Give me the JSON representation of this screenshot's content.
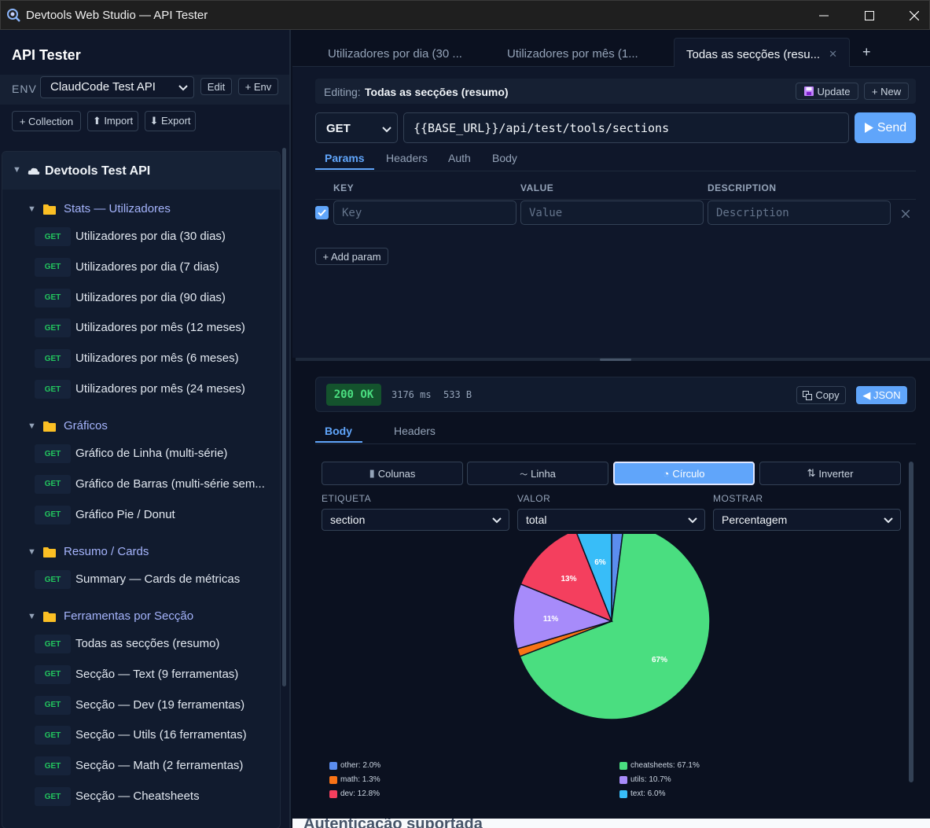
{
  "window": {
    "title": "Devtools Web Studio — API Tester"
  },
  "sidebar": {
    "title": "API Tester",
    "env_label": "ENV",
    "env_value": "ClaudCode Test API",
    "edit_label": "Edit",
    "add_env_label": "+ Env",
    "collection_label": "+ Collection",
    "import_label": "⬆ Import",
    "export_label": "⬇ Export",
    "root": "Devtools Test API",
    "folders": [
      {
        "name": "Stats — Utilizadores",
        "items": [
          {
            "method": "GET",
            "label": "Utilizadores por dia (30 dias)"
          },
          {
            "method": "GET",
            "label": "Utilizadores por dia (7 dias)"
          },
          {
            "method": "GET",
            "label": "Utilizadores por dia (90 dias)"
          },
          {
            "method": "GET",
            "label": "Utilizadores por mês (12 meses)"
          },
          {
            "method": "GET",
            "label": "Utilizadores por mês (6 meses)"
          },
          {
            "method": "GET",
            "label": "Utilizadores por mês (24 meses)"
          }
        ]
      },
      {
        "name": "Gráficos",
        "items": [
          {
            "method": "GET",
            "label": "Gráfico de Linha (multi-série)"
          },
          {
            "method": "GET",
            "label": "Gráfico de Barras (multi-série sem..."
          },
          {
            "method": "GET",
            "label": "Gráfico Pie / Donut"
          }
        ]
      },
      {
        "name": "Resumo / Cards",
        "items": [
          {
            "method": "GET",
            "label": "Summary — Cards de métricas"
          }
        ]
      },
      {
        "name": "Ferramentas por Secção",
        "items": [
          {
            "method": "GET",
            "label": "Todas as secções (resumo)"
          },
          {
            "method": "GET",
            "label": "Secção — Text (9 ferramentas)"
          },
          {
            "method": "GET",
            "label": "Secção — Dev (19 ferramentas)"
          },
          {
            "method": "GET",
            "label": "Secção — Utils (16 ferramentas)"
          },
          {
            "method": "GET",
            "label": "Secção — Math (2 ferramentas)"
          },
          {
            "method": "GET",
            "label": "Secção — Cheatsheets"
          }
        ]
      }
    ]
  },
  "tabs": [
    {
      "label": "Utilizadores por dia (30 ..."
    },
    {
      "label": "Utilizadores por mês (1..."
    },
    {
      "label": "Todas as secções (resu...",
      "close": "✕"
    }
  ],
  "add_tab": "+",
  "editor": {
    "editing_label": "Editing:",
    "editing_value": "Todas as secções (resumo)",
    "update_label": "Update",
    "new_label": "+ New",
    "method": "GET",
    "url": "{{BASE_URL}}/api/test/tools/sections",
    "send_label": "Send",
    "subtabs": [
      "Params",
      "Headers",
      "Auth",
      "Body"
    ],
    "columns": [
      "KEY",
      "VALUE",
      "DESCRIPTION"
    ],
    "placeholders": {
      "key": "Key",
      "value": "Value",
      "description": "Description"
    },
    "add_param_label": "+ Add param"
  },
  "response": {
    "status": "200 OK",
    "time": "3176 ms",
    "size": "533 B",
    "copy_label": "Copy",
    "json_label": "◀ JSON",
    "subtabs": [
      "Body",
      "Headers"
    ],
    "chart_buttons": [
      {
        "icon": "▮",
        "label": "Colunas"
      },
      {
        "icon": "〜",
        "label": "Linha"
      },
      {
        "icon": "◔",
        "label": "Círculo"
      },
      {
        "icon": "⇅",
        "label": "Inverter"
      }
    ],
    "selects": [
      {
        "label": "ETIQUETA",
        "value": "section"
      },
      {
        "label": "VALOR",
        "value": "total"
      },
      {
        "label": "MOSTRAR",
        "value": "Percentagem"
      }
    ]
  },
  "chart_data": {
    "type": "pie",
    "categories": [
      "other",
      "cheatsheets",
      "math",
      "utils",
      "dev",
      "text"
    ],
    "values": [
      2.0,
      67.1,
      1.3,
      10.7,
      12.8,
      6.0
    ],
    "legend": [
      "other: 2.0%",
      "cheatsheets: 67.1%",
      "math: 1.3%",
      "utils: 10.7%",
      "dev: 12.8%",
      "text: 6.0%"
    ],
    "colors": [
      "#5b8def",
      "#4ade80",
      "#f97316",
      "#a78bfa",
      "#f43f5e",
      "#38bdf8"
    ],
    "slice_labels": [
      "",
      "67%",
      "",
      "11%",
      "13%",
      "6%"
    ],
    "legend_placement": "bottom"
  },
  "footer_peek": "Autenticação suportada"
}
